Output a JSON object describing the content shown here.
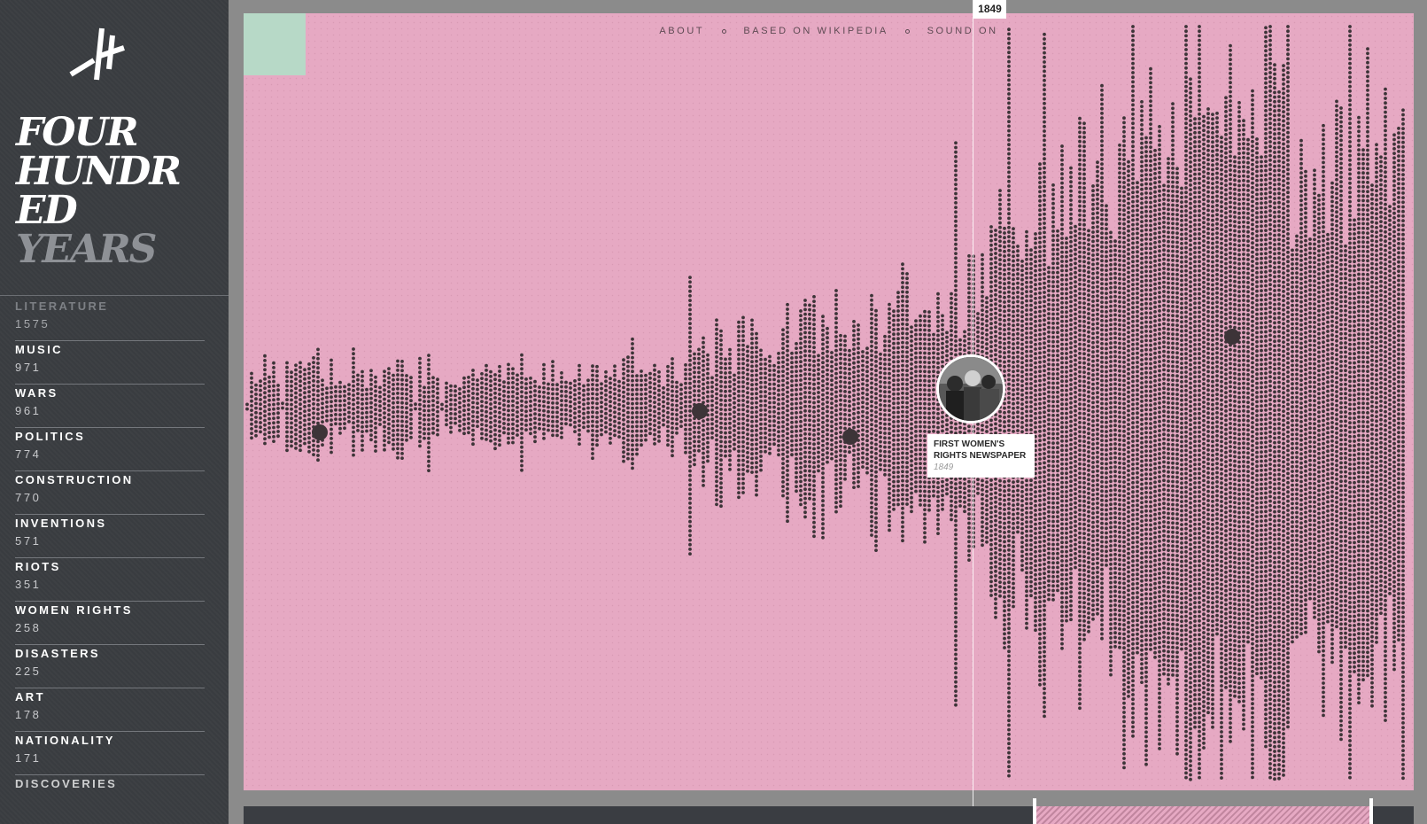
{
  "site": {
    "title_lines": [
      "FOUR",
      "HUNDR",
      "ED"
    ],
    "title_dim": "YEARS"
  },
  "nav": {
    "about": "ABOUT",
    "based_on": "BASED ON WIKIPEDIA",
    "sound": "SOUND ON"
  },
  "categories": [
    {
      "name": "LITERATURE",
      "count": "1575"
    },
    {
      "name": "MUSIC",
      "count": "971"
    },
    {
      "name": "WARS",
      "count": "961"
    },
    {
      "name": "POLITICS",
      "count": "774"
    },
    {
      "name": "CONSTRUCTION",
      "count": "770"
    },
    {
      "name": "INVENTIONS",
      "count": "571"
    },
    {
      "name": "RIOTS",
      "count": "351"
    },
    {
      "name": "WOMEN RIGHTS",
      "count": "258"
    },
    {
      "name": "DISASTERS",
      "count": "225"
    },
    {
      "name": "ART",
      "count": "178"
    },
    {
      "name": "NATIONALITY",
      "count": "171"
    },
    {
      "name": "DISCOVERIES",
      "count": ""
    }
  ],
  "timeline": {
    "current_year": "1849"
  },
  "event": {
    "title": "FIRST WOMEN'S RIGHTS NEWSPAPER",
    "year": "1849"
  },
  "colors": {
    "background": "#e6a9c3",
    "dots": "#3d3438",
    "sidebar": "#393c40",
    "accent": "#b7d9c7"
  },
  "icons": {
    "logo": "stylized-hash-logo"
  }
}
